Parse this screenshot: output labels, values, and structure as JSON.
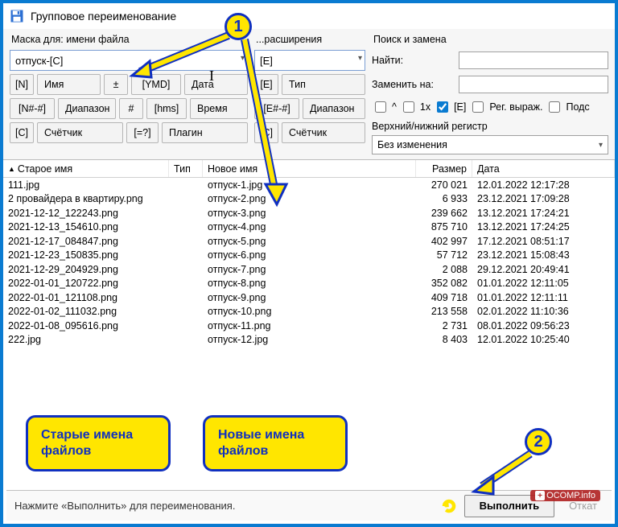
{
  "window": {
    "title": "Групповое переименование"
  },
  "mask": {
    "label": "Маска для: имени файла",
    "value": "отпуск-[C]",
    "buttons": {
      "n": "[N]",
      "name": "Имя",
      "plusminus": "±",
      "ymd": "[YMD]",
      "date": "Дата",
      "range_token": "[N#-#]",
      "range": "Диапазон",
      "hash": "#",
      "hms": "[hms]",
      "time": "Время",
      "c": "[C]",
      "counter": "Счётчик",
      "eqq": "[=?]",
      "plugin": "Плагин"
    }
  },
  "ext": {
    "label": "...расширения",
    "value": "[E]",
    "buttons": {
      "e": "[E]",
      "type": "Тип",
      "range_token": "[E#-#]",
      "range": "Диапазон",
      "c": "[C]",
      "counter": "Счётчик"
    }
  },
  "search": {
    "label": "Поиск и замена",
    "find": "Найти:",
    "replace": "Заменить на:",
    "chk_caret": "^",
    "chk_1x": "1x",
    "chk_e": "[E]",
    "chk_regex": "Рег. выраж.",
    "chk_subst": "Подс",
    "case_label": "Верхний/нижний регистр",
    "case_value": "Без изменения"
  },
  "table": {
    "headers": {
      "old": "Старое имя",
      "ext": "Тип",
      "new": "Новое имя",
      "size": "Размер",
      "date": "Дата"
    },
    "rows": [
      {
        "old": "111.jpg",
        "new": "отпуск-1.jpg",
        "size": "270 021",
        "date": "12.01.2022 12:17:28"
      },
      {
        "old": "2 провайдера в квартиру.png",
        "new": "отпуск-2.png",
        "size": "6 933",
        "date": "23.12.2021 17:09:28"
      },
      {
        "old": "2021-12-12_122243.png",
        "new": "отпуск-3.png",
        "size": "239 662",
        "date": "13.12.2021 17:24:21"
      },
      {
        "old": "2021-12-13_154610.png",
        "new": "отпуск-4.png",
        "size": "875 710",
        "date": "13.12.2021 17:24:25"
      },
      {
        "old": "2021-12-17_084847.png",
        "new": "отпуск-5.png",
        "size": "402 997",
        "date": "17.12.2021 08:51:17"
      },
      {
        "old": "2021-12-23_150835.png",
        "new": "отпуск-6.png",
        "size": "57 712",
        "date": "23.12.2021 15:08:43"
      },
      {
        "old": "2021-12-29_204929.png",
        "new": "отпуск-7.png",
        "size": "2 088",
        "date": "29.12.2021 20:49:41"
      },
      {
        "old": "2022-01-01_120722.png",
        "new": "отпуск-8.png",
        "size": "352 082",
        "date": "01.01.2022 12:11:05"
      },
      {
        "old": "2022-01-01_121108.png",
        "new": "отпуск-9.png",
        "size": "409 718",
        "date": "01.01.2022 12:11:11"
      },
      {
        "old": "2022-01-02_111032.png",
        "new": "отпуск-10.png",
        "size": "213 558",
        "date": "02.01.2022 11:10:36"
      },
      {
        "old": "2022-01-08_095616.png",
        "new": "отпуск-11.png",
        "size": "2 731",
        "date": "08.01.2022 09:56:23"
      },
      {
        "old": "222.jpg",
        "new": "отпуск-12.jpg",
        "size": "8 403",
        "date": "12.01.2022 10:25:40"
      }
    ]
  },
  "footer": {
    "hint": "Нажмите «Выполнить» для переименования.",
    "execute": "Выполнить",
    "rollback": "Откат"
  },
  "annotations": {
    "num1": "1",
    "num2": "2",
    "old_names": "Старые имена файлов",
    "new_names": "Новые имена файлов"
  },
  "watermark": "OCOMP.info"
}
